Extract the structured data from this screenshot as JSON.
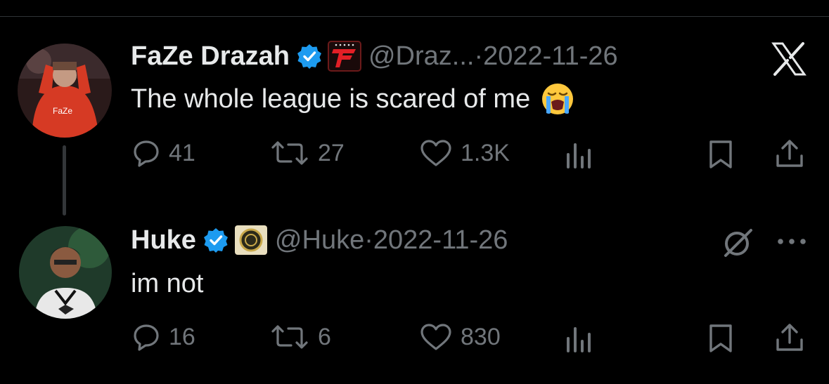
{
  "brand": {
    "icon": "x-logo-icon",
    "color": "#e7e9ea"
  },
  "colors": {
    "verified": "#1d9bf0",
    "muted": "#71767b",
    "text": "#e7e9ea"
  },
  "tweets": [
    {
      "name": "FaZe Drazah",
      "handle": "@Draz...",
      "separator": "·",
      "date": "2022-11-26",
      "text": "The whole league is scared of me",
      "emoji": "loudly-crying-face-icon",
      "affiliate": "faze-logo-icon",
      "replies": "41",
      "retweets": "27",
      "likes": "1.3K"
    },
    {
      "name": "Huke",
      "handle": "@Huke",
      "separator": "·",
      "date": "2022-11-26",
      "text": "im not",
      "affiliate": "optic-logo-icon",
      "replies": "16",
      "retweets": "6",
      "likes": "830"
    }
  ]
}
